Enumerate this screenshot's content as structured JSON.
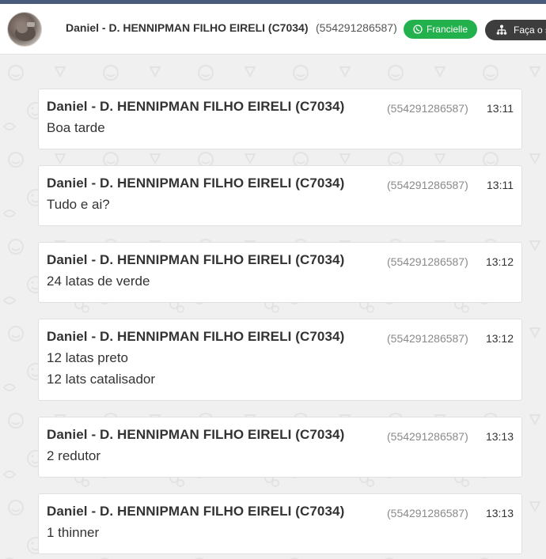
{
  "header": {
    "contact_name": "Daniel - D. HENNIPMAN FILHO EIRELI (C7034)",
    "contact_phone": "(554291286587)",
    "agent_badge": "Francielle",
    "agent_badge_color": "#22b14c",
    "action_button": "Faça o s"
  },
  "messages": [
    {
      "sender": "Daniel - D. HENNIPMAN FILHO EIRELI (C7034)",
      "phone": "(554291286587)",
      "time": "13:11",
      "lines": [
        "Boa tarde"
      ]
    },
    {
      "sender": "Daniel - D. HENNIPMAN FILHO EIRELI (C7034)",
      "phone": "(554291286587)",
      "time": "13:11",
      "lines": [
        "Tudo e ai?"
      ]
    },
    {
      "sender": "Daniel - D. HENNIPMAN FILHO EIRELI (C7034)",
      "phone": "(554291286587)",
      "time": "13:12",
      "lines": [
        "24 latas de verde"
      ]
    },
    {
      "sender": "Daniel - D. HENNIPMAN FILHO EIRELI (C7034)",
      "phone": "(554291286587)",
      "time": "13:12",
      "lines": [
        "12 latas preto",
        "12 lats catalisador"
      ]
    },
    {
      "sender": "Daniel - D. HENNIPMAN FILHO EIRELI (C7034)",
      "phone": "(554291286587)",
      "time": "13:13",
      "lines": [
        "2 redutor"
      ]
    },
    {
      "sender": "Daniel - D. HENNIPMAN FILHO EIRELI (C7034)",
      "phone": "(554291286587)",
      "time": "13:13",
      "lines": [
        "1 thinner"
      ]
    }
  ]
}
